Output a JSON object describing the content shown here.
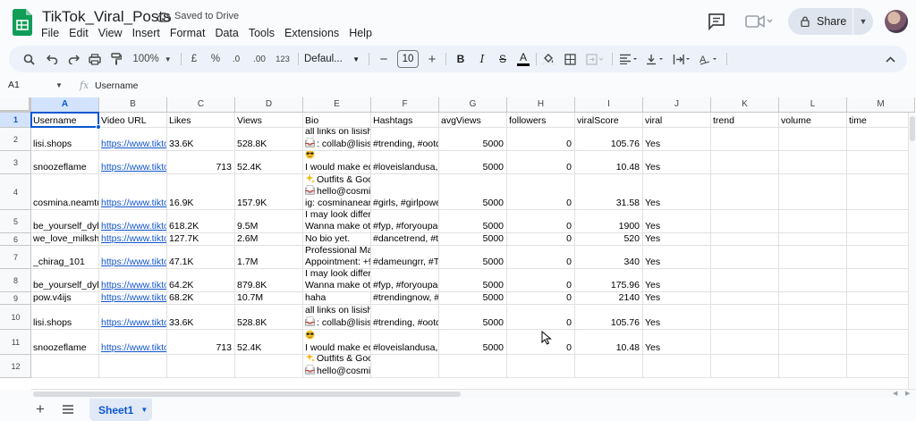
{
  "app": {
    "doc_title": "TikTok_Viral_Posts",
    "save_status": "Saved to Drive",
    "menu": [
      "File",
      "Edit",
      "View",
      "Insert",
      "Format",
      "Data",
      "Tools",
      "Extensions",
      "Help"
    ],
    "share_label": "Share",
    "brand_color": "#0f9d58"
  },
  "toolbar": {
    "zoom": "100%",
    "currency": "£",
    "percent": "%",
    "decimal_decrease": ".0",
    "decimal_increase": ".00",
    "number_format": "123",
    "font": "Defaul...",
    "font_size": "10",
    "minus": "−",
    "plus": "+"
  },
  "formula_bar": {
    "cell_ref": "A1",
    "fx": "fx",
    "value": "Username"
  },
  "grid": {
    "columns": [
      "A",
      "B",
      "C",
      "D",
      "E",
      "F",
      "G",
      "H",
      "I",
      "J",
      "K",
      "L",
      "M"
    ],
    "row_numbers": [
      "1",
      "2",
      "3",
      "4",
      "5",
      "6",
      "7",
      "8",
      "9",
      "10",
      "11",
      "12"
    ],
    "headers": [
      "Username",
      "Video URL",
      "Likes",
      "Views",
      "Bio",
      "Hashtags",
      "avgViews",
      "followers",
      "viralScore",
      "viral",
      "trend",
      "volume",
      "time"
    ],
    "rows": [
      {
        "username": "lisi.shops",
        "url": "https://www.tikto",
        "likes": "33.6K",
        "views": "528.8K",
        "bio1": "all links on lisishe",
        "bio2": ": collab@lisis",
        "bio2_emoji": "inbox",
        "hashtags": "#trending, #ootd",
        "avgViews": "5000",
        "followers": "0",
        "viralScore": "105.76",
        "viral": "Yes"
      },
      {
        "username": "snoozeflame",
        "url": "https://www.tikto",
        "likes": "713",
        "views": "52.4K",
        "bio1_emoji": "sunglasses",
        "bio2": "I would make ed",
        "hashtags": "#loveislandusa, #",
        "avgViews": "5000",
        "followers": "0",
        "viralScore": "10.48",
        "viral": "Yes"
      },
      {
        "username": "cosmina.neamtu",
        "url": "https://www.tikto",
        "likes": "16.9K",
        "views": "157.9K",
        "bio1": "Outfits & Goo",
        "bio1_emoji": "sparkles",
        "bio2": "hello@cosmi",
        "bio2_emoji": "inbox",
        "bio3": "ig: cosminanean",
        "hashtags": "#girls, #girlpowe",
        "avgViews": "5000",
        "followers": "0",
        "viralScore": "31.58",
        "viral": "Yes"
      },
      {
        "username": "be_yourself_dyla",
        "url": "https://www.tikto",
        "likes": "618.2K",
        "views": "9.5M",
        "bio1": "I may look differe",
        "bio2": "Wanna make oth",
        "hashtags": "#fyp, #foryoupag",
        "avgViews": "5000",
        "followers": "0",
        "viralScore": "1900",
        "viral": "Yes"
      },
      {
        "username": "we_love_milksha",
        "url": "https://www.tikto",
        "likes": "127.7K",
        "views": "2.6M",
        "bio1": "No bio yet.",
        "hashtags": "#dancetrend, #ti",
        "avgViews": "5000",
        "followers": "0",
        "viralScore": "520",
        "viral": "Yes"
      },
      {
        "username": "_chirag_101",
        "url": "https://www.tikto",
        "likes": "47.1K",
        "views": "1.7M",
        "bio1": "Professional Mak",
        "bio2": "Appointment: +9",
        "hashtags": "#dameungrr, #Tr",
        "avgViews": "5000",
        "followers": "0",
        "viralScore": "340",
        "viral": "Yes"
      },
      {
        "username": "be_yourself_dyla",
        "url": "https://www.tikto",
        "likes": "64.2K",
        "views": "879.8K",
        "bio1": "I may look differe",
        "bio2": "Wanna make oth",
        "hashtags": "#fyp, #foryoupag",
        "avgViews": "5000",
        "followers": "0",
        "viralScore": "175.96",
        "viral": "Yes"
      },
      {
        "username": "pow.v4ijs",
        "url": "https://www.tikto",
        "likes": "68.2K",
        "views": "10.7M",
        "bio1": "haha",
        "hashtags": "#trendingnow, #t",
        "avgViews": "5000",
        "followers": "0",
        "viralScore": "2140",
        "viral": "Yes"
      },
      {
        "username": "lisi.shops",
        "url": "https://www.tikto",
        "likes": "33.6K",
        "views": "528.8K",
        "bio1": "all links on lisishe",
        "bio2": ": collab@lisis",
        "bio2_emoji": "inbox",
        "hashtags": "#trending, #ootd",
        "avgViews": "5000",
        "followers": "0",
        "viralScore": "105.76",
        "viral": "Yes"
      },
      {
        "username": "snoozeflame",
        "url": "https://www.tikto",
        "likes": "713",
        "views": "52.4K",
        "bio1_emoji": "sunglasses",
        "bio2": "I would make ed",
        "hashtags": "#loveislandusa, #",
        "avgViews": "5000",
        "followers": "0",
        "viralScore": "10.48",
        "viral": "Yes"
      },
      {
        "username": "",
        "url": "",
        "likes": "",
        "views": "",
        "bio1": "Outfits & Goo",
        "bio1_emoji": "sparkles",
        "bio2": "hello@cosmi",
        "bio2_emoji": "inbox",
        "hashtags": "",
        "avgViews": "",
        "followers": "",
        "viralScore": "",
        "viral": ""
      }
    ]
  },
  "sheets": {
    "tabs": [
      "Sheet1"
    ],
    "add_label": "+"
  }
}
